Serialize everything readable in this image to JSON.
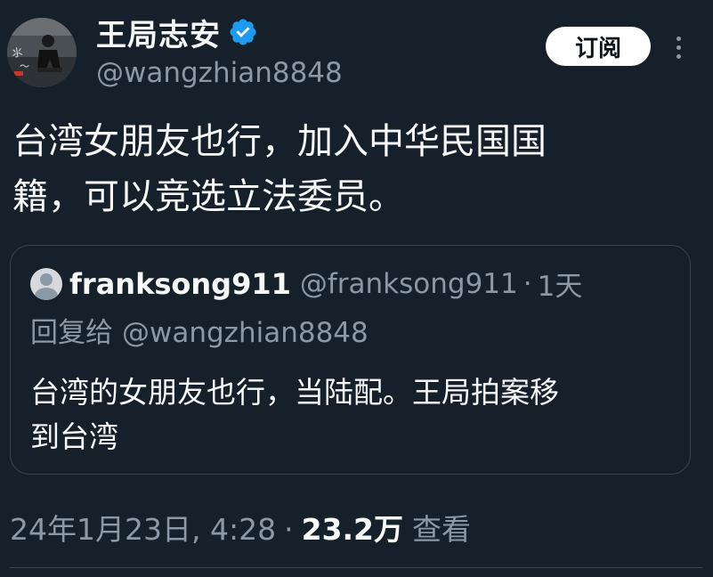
{
  "author": {
    "display_name": "王局志安",
    "handle": "@wangzhian8848",
    "verified": true,
    "avatar_icon": "user-photo-avatar"
  },
  "actions": {
    "subscribe_label": "订阅",
    "more_icon": "more-vertical-icon"
  },
  "tweet": {
    "text": "台湾女朋友也行，加入中华民国国\n籍，可以竞选立法委员。"
  },
  "quote": {
    "display_name": "franksong911",
    "handle": "@franksong911",
    "separator": "·",
    "time": "1天",
    "reply_prefix": "回复给",
    "reply_handle": "@wangzhian8848",
    "text": "台湾的女朋友也行，当陆配。王局拍案移\n到台湾"
  },
  "meta": {
    "date": "24年1月23日, 4:28",
    "separator": "·",
    "views_count": "23.2万",
    "views_label": "查看"
  },
  "colors": {
    "background": "#15202b",
    "primary_text": "#f7f9f9",
    "secondary_text": "#8b98a5",
    "border": "#38444d",
    "verified_badge": "#1d9bf0"
  }
}
